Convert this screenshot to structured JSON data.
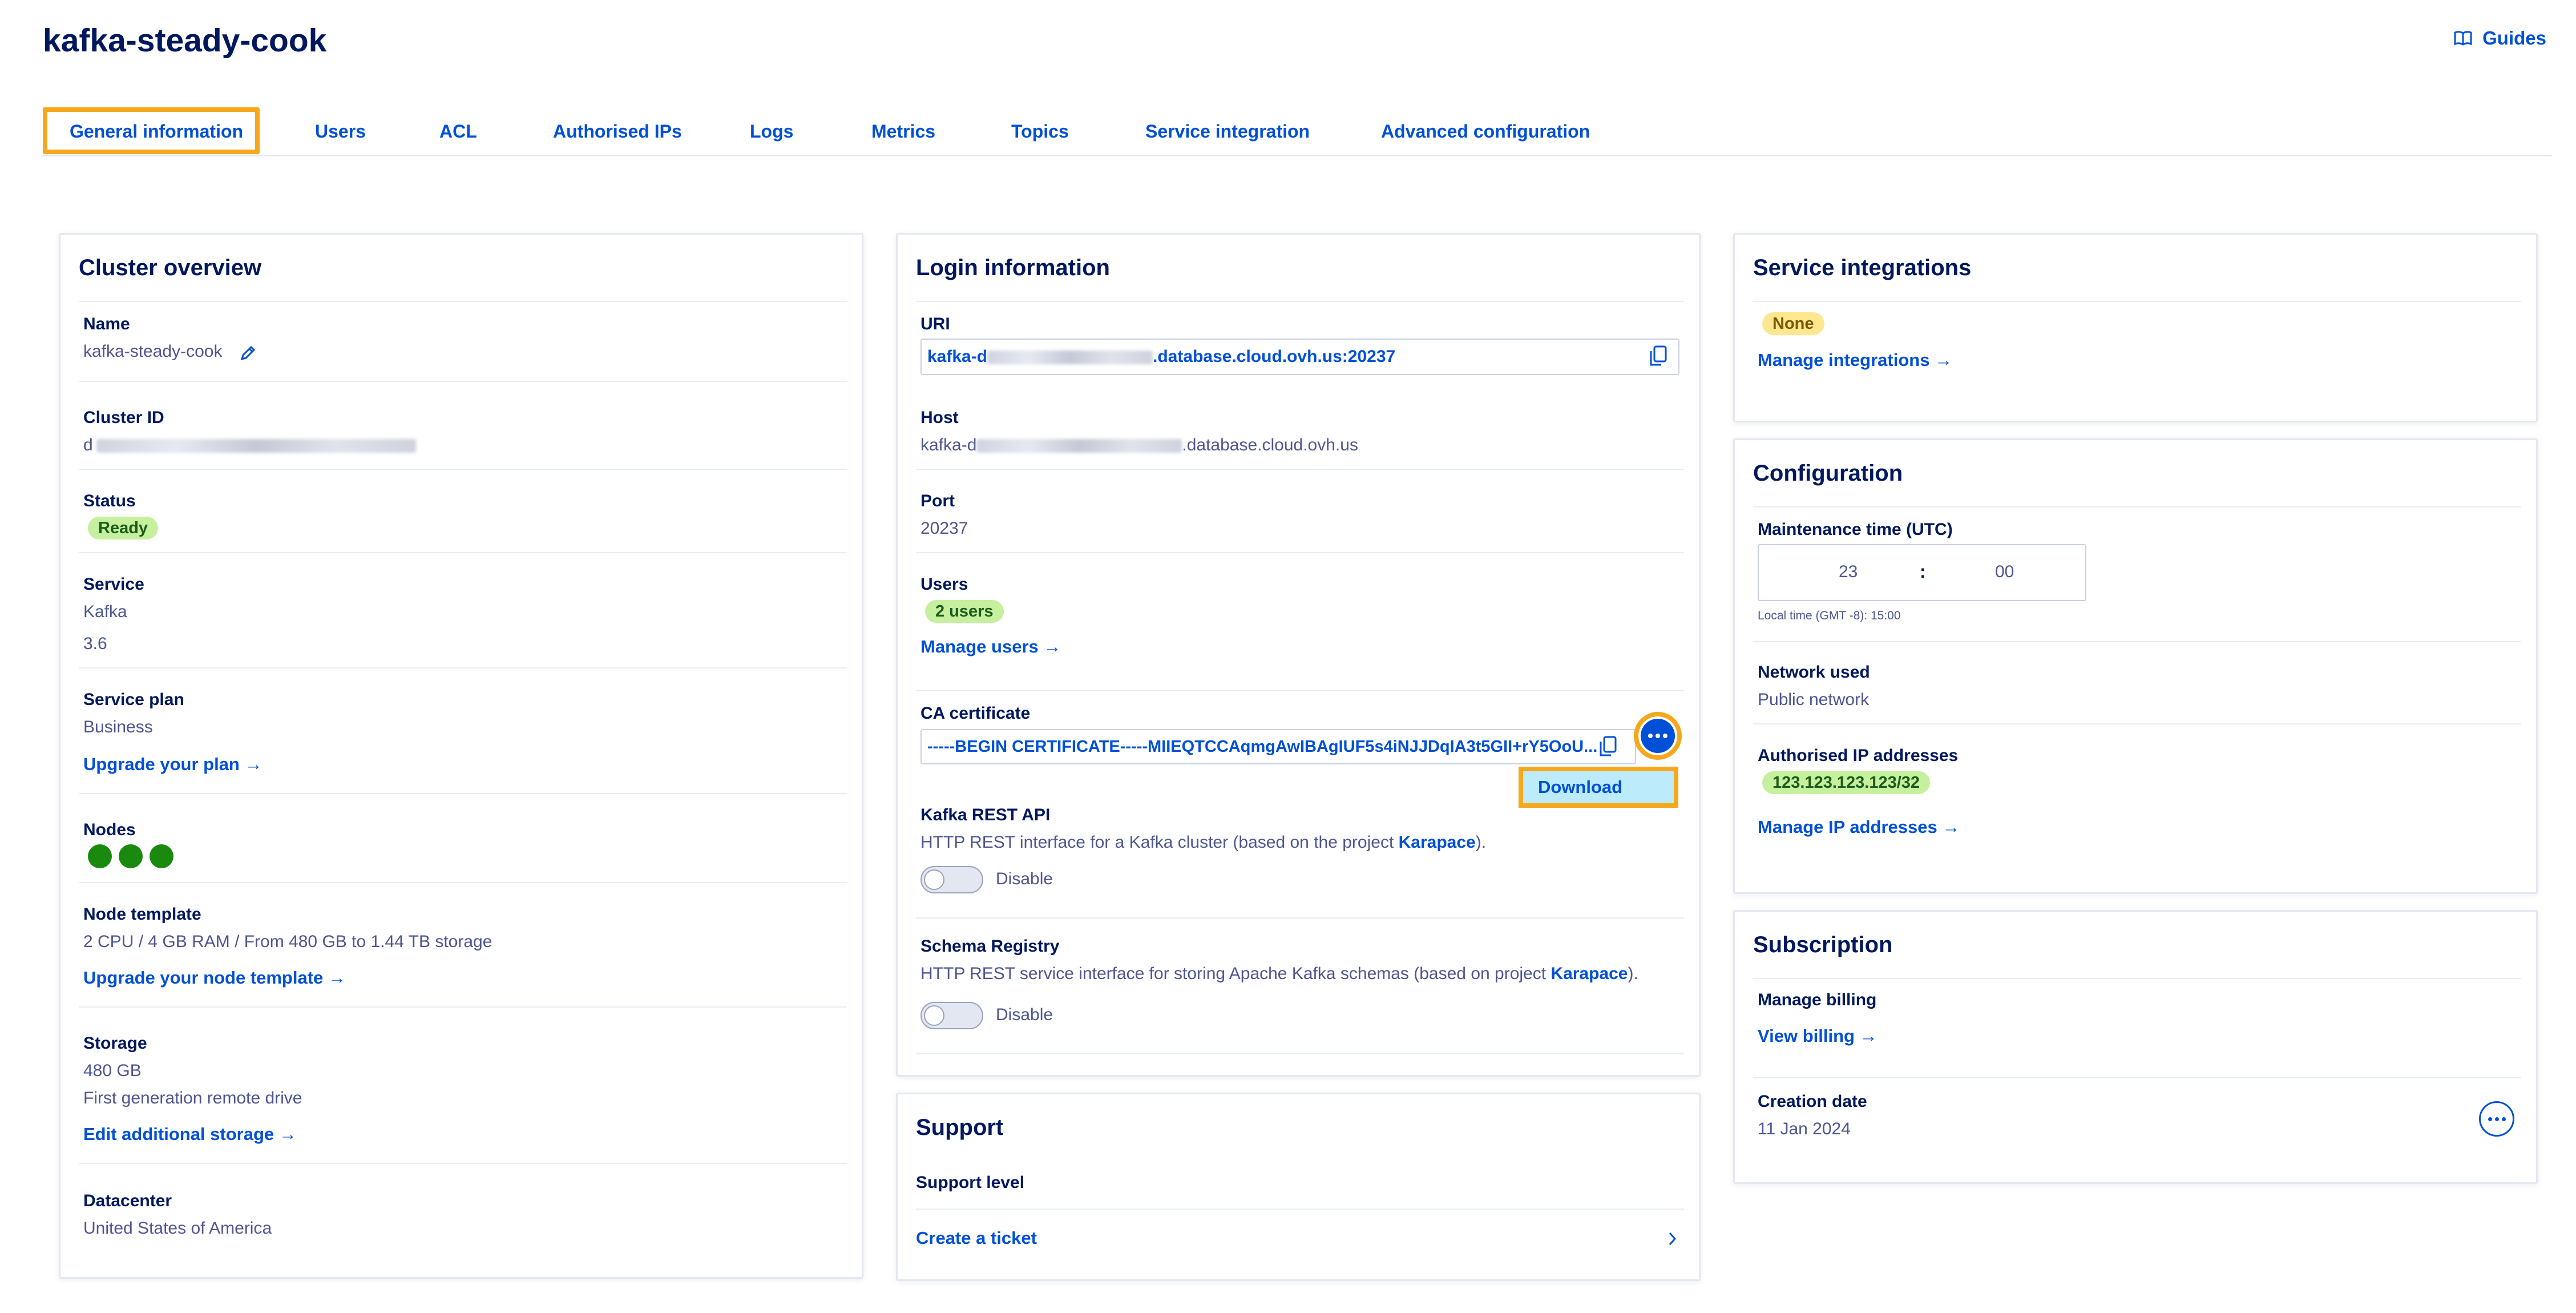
{
  "page": {
    "title": "kafka-steady-cook",
    "guides_label": "Guides"
  },
  "tabs": [
    "General information",
    "Users",
    "ACL",
    "Authorised IPs",
    "Logs",
    "Metrics",
    "Topics",
    "Service integration",
    "Advanced configuration"
  ],
  "cluster_overview": {
    "heading": "Cluster overview",
    "name_label": "Name",
    "name_value": "kafka-steady-cook",
    "cluster_id_label": "Cluster ID",
    "cluster_id_prefix": "d",
    "status_label": "Status",
    "status_value": "Ready",
    "service_label": "Service",
    "service_name": "Kafka",
    "service_version": "3.6",
    "plan_label": "Service plan",
    "plan_value": "Business",
    "upgrade_plan_link": "Upgrade your plan →",
    "nodes_label": "Nodes",
    "node_template_label": "Node template",
    "node_template_value": "2 CPU / 4 GB RAM / From 480 GB to 1.44 TB storage",
    "upgrade_node_link": "Upgrade your node template →",
    "storage_label": "Storage",
    "storage_value": "480 GB",
    "storage_type": "First generation remote drive",
    "edit_storage_link": "Edit additional storage →",
    "datacenter_label": "Datacenter",
    "datacenter_value": "United States of America"
  },
  "login_information": {
    "heading": "Login information",
    "uri_label": "URI",
    "uri_prefix": "kafka-d",
    "uri_suffix": ".database.cloud.ovh.us:20237",
    "host_label": "Host",
    "host_prefix": "kafka-d",
    "host_suffix": ".database.cloud.ovh.us",
    "port_label": "Port",
    "port_value": "20237",
    "users_label": "Users",
    "users_badge": "2 users",
    "manage_users_link": "Manage users →",
    "ca_label": "CA certificate",
    "ca_value": "-----BEGIN CERTIFICATE-----MIIEQTCCAqmgAwIBAgIUF5s4iNJJDqIA3t5GII+rY5OoU...",
    "download_label": "Download",
    "rest_label": "Kafka REST API",
    "rest_desc": "HTTP REST interface for a Kafka cluster (based on the project ",
    "rest_link": "Karapace",
    "rest_end": ").",
    "rest_toggle": "Disable",
    "schema_label": "Schema Registry",
    "schema_desc": "HTTP REST service interface for storing Apache Kafka schemas (based on project ",
    "schema_link": "Karapace",
    "schema_end": ").",
    "schema_toggle": "Disable"
  },
  "support": {
    "heading": "Support",
    "level_label": "Support level",
    "ticket_link": "Create a ticket"
  },
  "service_integrations": {
    "heading": "Service integrations",
    "badge": "None",
    "manage_link": "Manage integrations →"
  },
  "configuration": {
    "heading": "Configuration",
    "maintenance_label": "Maintenance time (UTC)",
    "hour": "23",
    "colon": ":",
    "minute": "00",
    "local_time": "Local time (GMT -8): 15:00",
    "network_label": "Network used",
    "network_value": "Public network",
    "ip_label": "Authorised IP addresses",
    "ip_value": "123.123.123.123/32",
    "manage_ip_link": "Manage IP addresses →"
  },
  "subscription": {
    "heading": "Subscription",
    "billing_label": "Manage billing",
    "billing_link": "View billing →",
    "creation_label": "Creation date",
    "creation_value": "11 Jan 2024"
  },
  "colors": {
    "accent": "#0050d7",
    "highlight": "#f6a81c",
    "navy": "#00185e",
    "ready_green": "#c6ef9e"
  }
}
